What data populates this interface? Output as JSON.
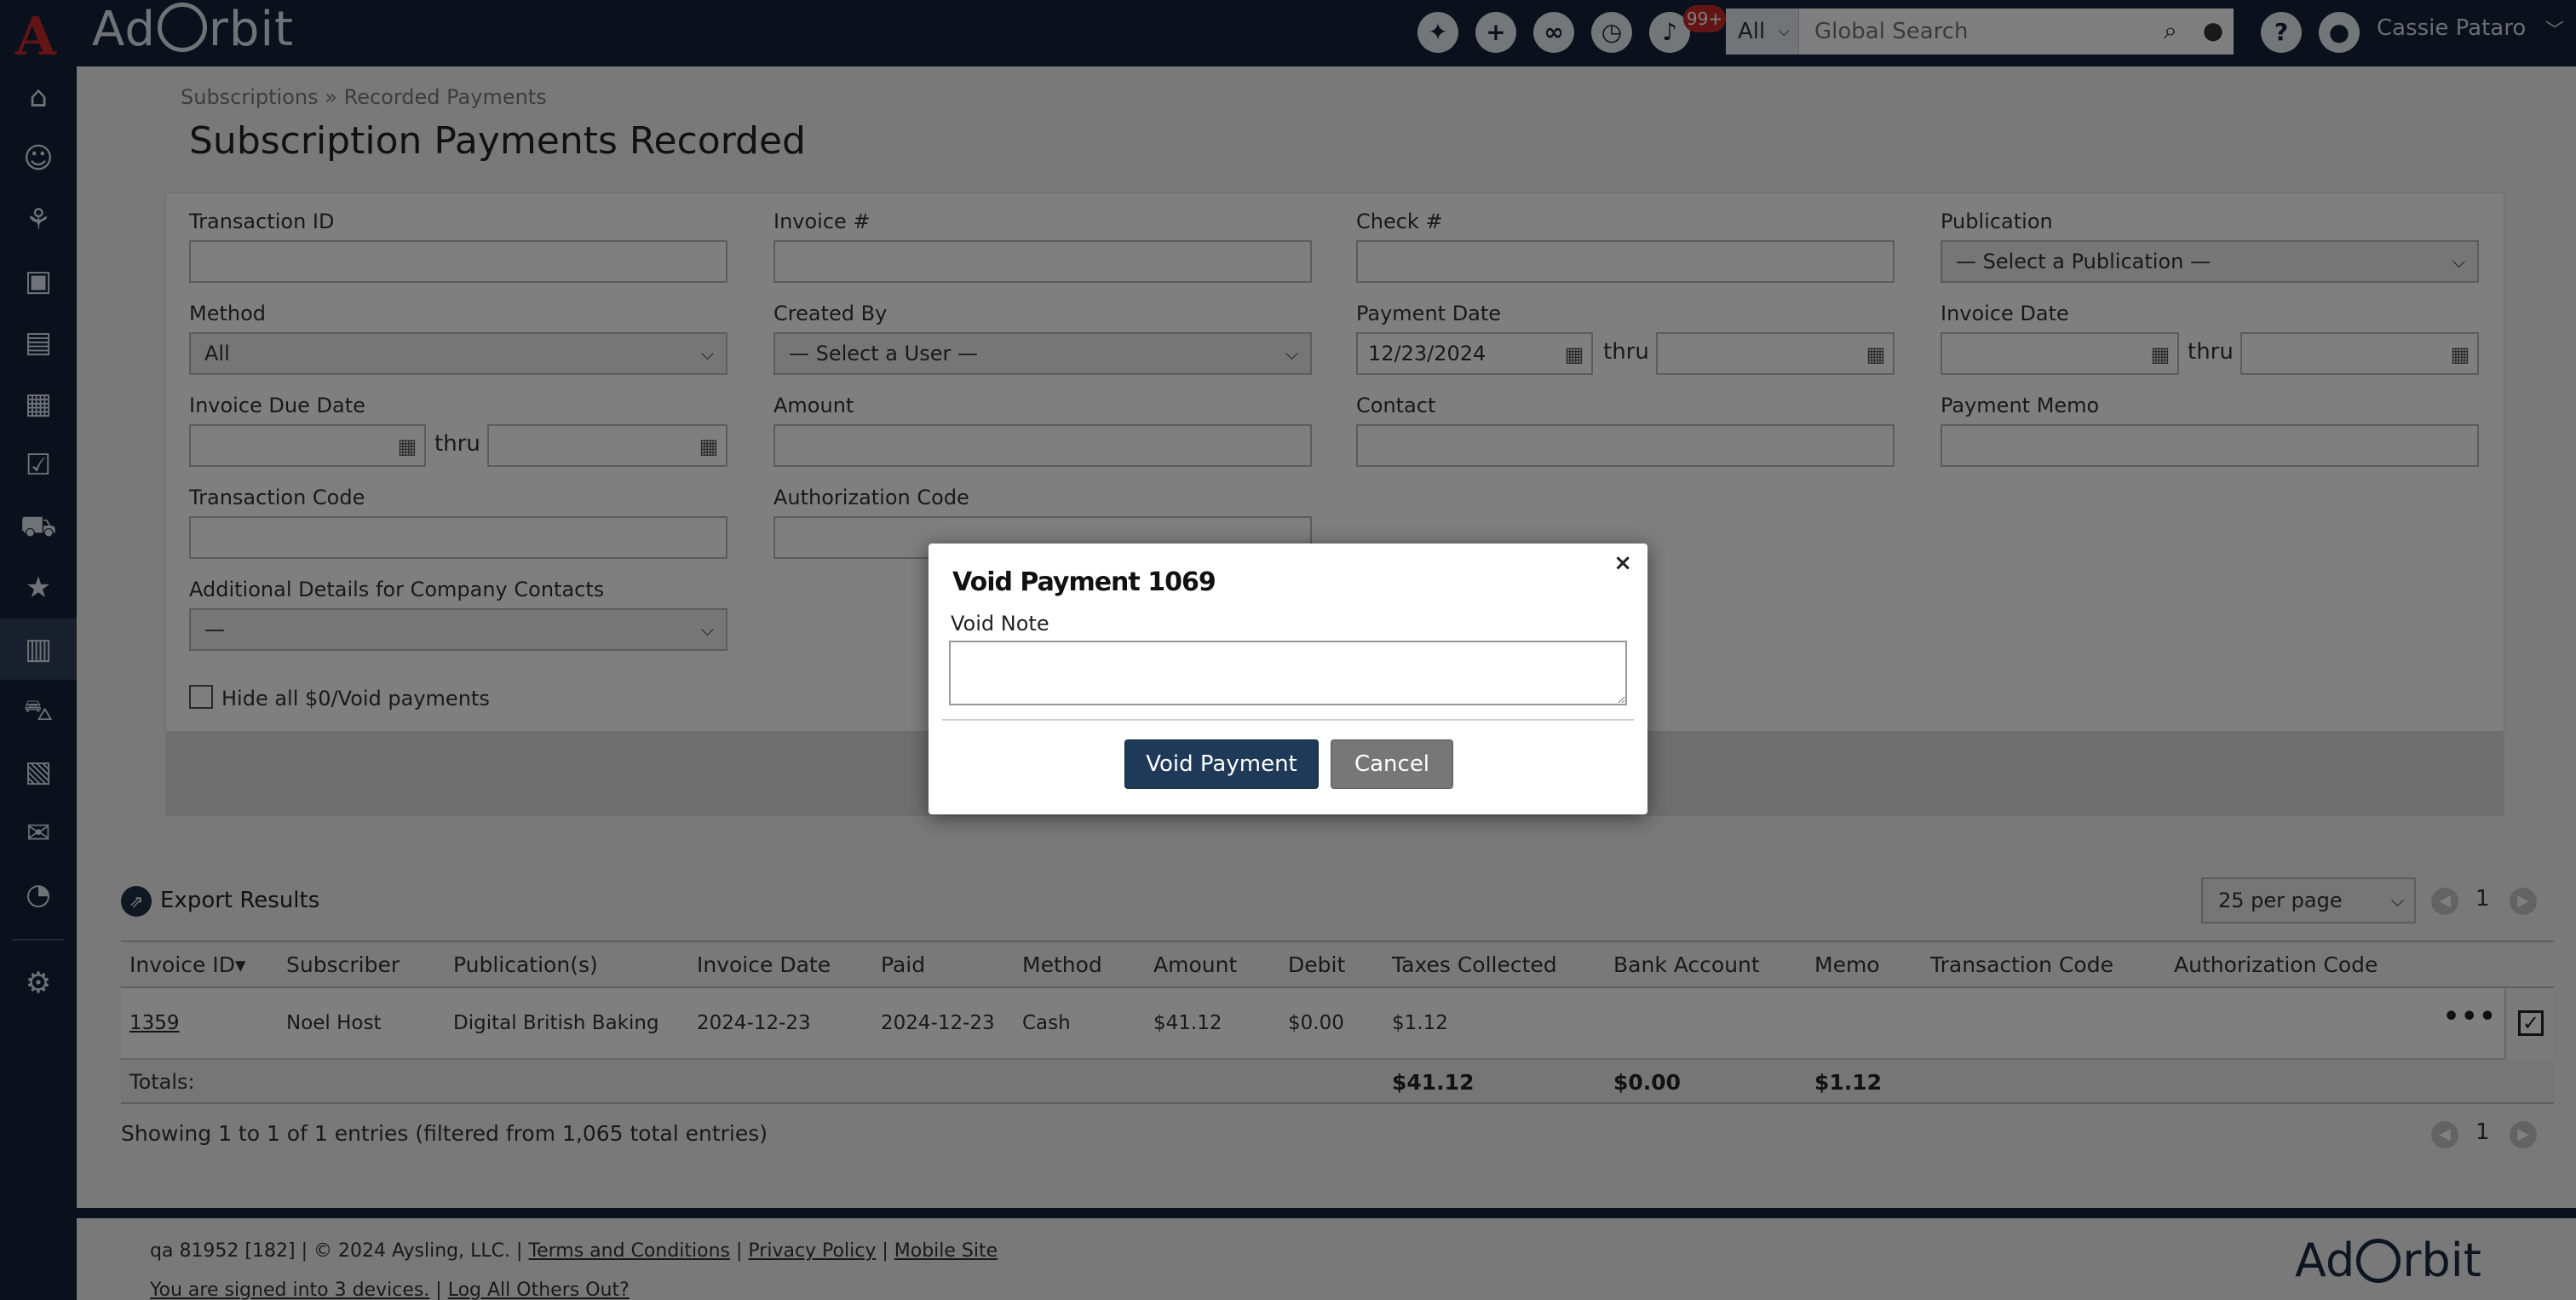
{
  "app": {
    "brand": "Ad Orbit",
    "brand_left": "Ad",
    "brand_right": "rbit"
  },
  "topbar": {
    "notifications_badge": "99+",
    "search_scope": "All",
    "search_placeholder": "Global Search",
    "user_name": "Cassie Pataro",
    "icons": [
      "party-icon",
      "plus-icon",
      "link-icon",
      "history-icon",
      "bell-icon",
      "help-icon",
      "user-icon"
    ]
  },
  "sidebar": {
    "items": [
      "home-icon",
      "people-icon",
      "handshake-icon",
      "image-icon",
      "document-icon",
      "ad-icon",
      "checklist-icon",
      "cart-icon",
      "calendar-star-icon",
      "newspaper-icon",
      "truck-icon",
      "w2-icon",
      "mail-icon",
      "chart-icon",
      "gear-icon"
    ],
    "active_index": 9
  },
  "breadcrumb": {
    "parent": "Subscriptions",
    "sep": "»",
    "current": "Recorded Payments"
  },
  "page_title": "Subscription Payments Recorded",
  "filters": {
    "transaction_id": {
      "label": "Transaction ID",
      "value": ""
    },
    "invoice_no": {
      "label": "Invoice #",
      "value": ""
    },
    "check_no": {
      "label": "Check #",
      "value": ""
    },
    "publication": {
      "label": "Publication",
      "value": "— Select a Publication —"
    },
    "method": {
      "label": "Method",
      "value": "All"
    },
    "created_by": {
      "label": "Created By",
      "value": "— Select a User —"
    },
    "payment_date": {
      "label": "Payment Date",
      "from": "12/23/2024",
      "to": ""
    },
    "invoice_date": {
      "label": "Invoice Date",
      "from": "",
      "to": ""
    },
    "invoice_due_date": {
      "label": "Invoice Due Date",
      "from": "",
      "to": ""
    },
    "amount": {
      "label": "Amount",
      "value": ""
    },
    "contact": {
      "label": "Contact",
      "value": ""
    },
    "payment_memo": {
      "label": "Payment Memo",
      "value": ""
    },
    "transaction_code": {
      "label": "Transaction Code",
      "value": ""
    },
    "authorization_code": {
      "label": "Authorization Code",
      "value": ""
    },
    "additional_details": {
      "label": "Additional Details for Company Contacts",
      "value": "—"
    },
    "thru": "thru",
    "hide_void": {
      "label": "Hide all $0/Void payments",
      "checked": false
    }
  },
  "results": {
    "export_label": "Export Results",
    "per_page": "25 per page",
    "page": "1",
    "columns": [
      "Invoice ID",
      "Subscriber",
      "Publication(s)",
      "Invoice Date",
      "Paid",
      "Method",
      "Amount",
      "Debit",
      "Taxes Collected",
      "Bank Account",
      "Memo",
      "Transaction Code",
      "Authorization Code"
    ],
    "sort_indicator": "▾",
    "rows": [
      {
        "invoice_id": "1359",
        "subscriber": "Noel Host",
        "publication": "Digital British Baking",
        "invoice_date": "2024-12-23",
        "paid": "2024-12-23",
        "method": "Cash",
        "amount": "$41.12",
        "debit": "$0.00",
        "taxes_collected": "$1.12"
      }
    ],
    "totals": {
      "label": "Totals:",
      "taxes_collected": "$41.12",
      "bank_account": "$0.00",
      "memo": "$1.12"
    },
    "showing": "Showing 1 to 1 of 1 entries (filtered from 1,065 total entries)"
  },
  "footer": {
    "env": "qa 81952 [182] | © 2024 Aysling, LLC. |",
    "terms": "Terms and Conditions",
    "privacy": "Privacy Policy",
    "mobile": "Mobile Site",
    "signed_in": "You are signed into 3 devices.",
    "log_out_others": "Log All Others Out?"
  },
  "modal": {
    "title": "Void Payment 1069",
    "close": "×",
    "note_label": "Void Note",
    "note_value": "",
    "void_button": "Void Payment",
    "cancel_button": "Cancel"
  },
  "colors": {
    "navy": "#14233a",
    "primary_button": "#1f3a58",
    "cancel_button": "#777777",
    "badge": "#c62828"
  }
}
